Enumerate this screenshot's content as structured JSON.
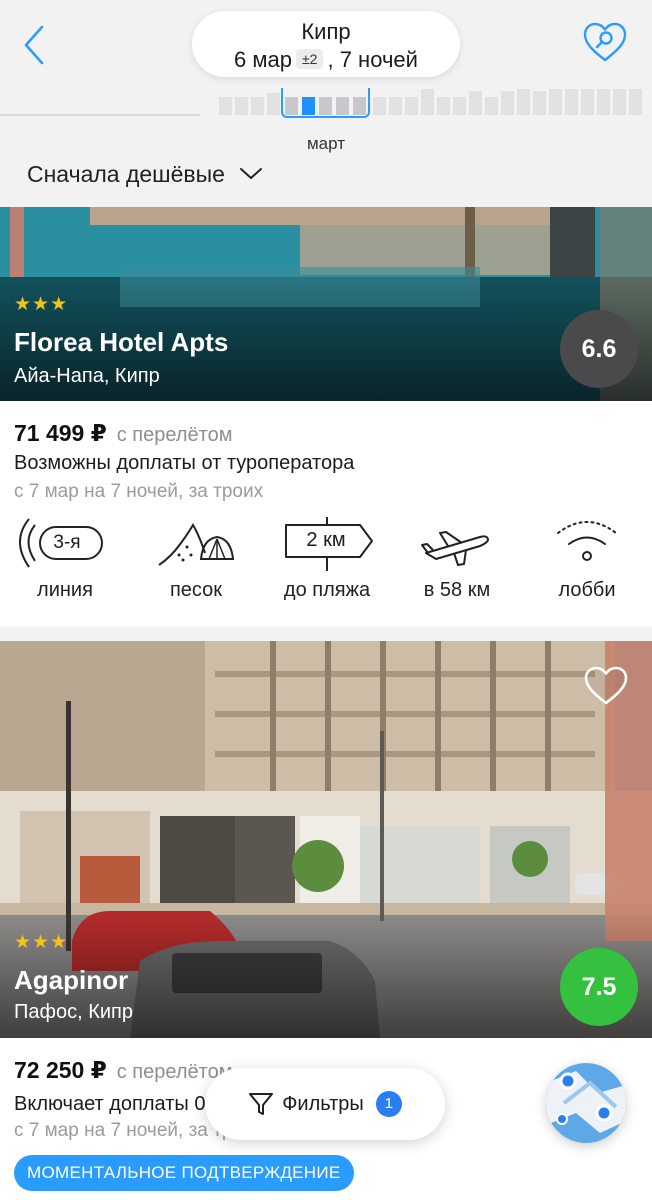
{
  "header": {
    "destination": "Кипр",
    "date": "6 мар",
    "flex": "±2",
    "nights": ", 7 ночей",
    "month": "март",
    "back_icon": "chevron-left-icon",
    "favorite_icon": "heart-search-icon"
  },
  "sort": {
    "label": "Сначала дешёвые",
    "icon": "chevron-down-icon"
  },
  "accent_color": "#2b9cff",
  "hotels": [
    {
      "stars": "★★★",
      "name": "Florea Hotel Apts",
      "location": "Айа-Напа, Кипр",
      "rating": "6.6",
      "rating_color": "#4a4a4d",
      "price": "71 499 ₽",
      "price_note": "с перелётом",
      "description": "Возможны доплаты от туроператора",
      "dates": "с 7 мар на 7 ночей, за троих",
      "features": [
        {
          "icon": "beach-line-icon",
          "badge": "3-я",
          "label": "линия"
        },
        {
          "icon": "sand-shell-icon",
          "label": "песок"
        },
        {
          "icon": "signpost-icon",
          "badge": "2 км",
          "label": "до пляжа"
        },
        {
          "icon": "airplane-icon",
          "label": "в 58 км"
        },
        {
          "icon": "wifi-icon",
          "label": "лобби"
        }
      ]
    },
    {
      "stars": "★★★",
      "name": "Agapinor",
      "location": "Пафос, Кипр",
      "rating": "7.5",
      "rating_color": "#34c13f",
      "price": "72 250 ₽",
      "price_note": "с перелётом",
      "description": "Включает доплаты 0 ₽",
      "dates": "с 7 мар на 7 ночей, за троих",
      "favorite_icon": "heart-outline-icon",
      "badge": "МОМЕНТАЛЬНОЕ ПОДТВЕРЖДЕНИЕ"
    }
  ],
  "filters": {
    "label": "Фильтры",
    "count": "1",
    "icon": "filter-funnel-icon"
  },
  "map": {
    "icon": "map-icon"
  }
}
